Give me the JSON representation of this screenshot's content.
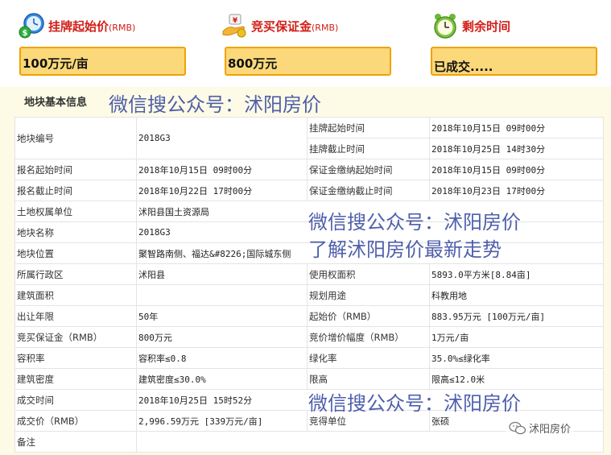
{
  "header": {
    "start_price_label": "挂牌起始价",
    "deposit_label": "竞买保证金",
    "remaining_label": "剩余时间",
    "unit_rmb": "(RMB)"
  },
  "values": {
    "start_price": "100万元/亩",
    "deposit": "800万元",
    "remaining": "已成交....."
  },
  "section_title": "地块基本信息",
  "watermarks": {
    "w1": "微信搜公众号：沭阳房价",
    "w2": "微信搜公众号：沭阳房价",
    "w3": "了解沭阳房价最新走势",
    "w4": "微信搜公众号：沭阳房价"
  },
  "brand": "沭阳房价",
  "table": {
    "r1": {
      "l1": "地块编号",
      "v1": "2018G3",
      "l2": "挂牌起始时间",
      "v2": "2018年10月15日 09时00分"
    },
    "r1b": {
      "l2": "挂牌截止时间",
      "v2": "2018年10月25日 14时30分"
    },
    "r2": {
      "l1": "报名起始时间",
      "v1": "2018年10月15日 09时00分",
      "l2": "保证金缴纳起始时间",
      "v2": "2018年10月15日 09时00分"
    },
    "r3": {
      "l1": "报名截止时间",
      "v1": "2018年10月22日 17时00分",
      "l2": "保证金缴纳截止时间",
      "v2": "2018年10月23日 17时00分"
    },
    "r4": {
      "l1": "土地权属单位",
      "v1": "沭阳县国土资源局"
    },
    "r5": {
      "l1": "地块名称",
      "v1": "2018G3"
    },
    "r6": {
      "l1": "地块位置",
      "v1": "聚智路南侧、福达&#8226;国际城东侧"
    },
    "r7": {
      "l1": "所属行政区",
      "v1": "沭阳县",
      "l2": "使用权面积",
      "v2": "5893.0平方米[8.84亩]"
    },
    "r8": {
      "l1": "建筑面积",
      "v1": "",
      "l2": "规划用途",
      "v2": "科教用地"
    },
    "r9": {
      "l1": "出让年限",
      "v1": "50年",
      "l2": "起始价（RMB）",
      "v2": "883.95万元 [100万元/亩]"
    },
    "r10": {
      "l1": "竞买保证金（RMB）",
      "v1": "800万元",
      "l2": "竞价增价幅度（RMB）",
      "v2": "1万元/亩"
    },
    "r11": {
      "l1": "容积率",
      "v1": "容积率≤0.8",
      "l2": "绿化率",
      "v2": "35.0%≤绿化率"
    },
    "r12": {
      "l1": "建筑密度",
      "v1": "建筑密度≤30.0%",
      "l2": "限高",
      "v2": "限高≤12.0米"
    },
    "r13": {
      "l1": "成交时间",
      "v1": "2018年10月25日 15时52分"
    },
    "r14": {
      "l1": "成交价（RMB）",
      "v1": "2,996.59万元 [339万元/亩]",
      "l2": "竞得单位",
      "v2": "张硕"
    },
    "r15": {
      "l1": "备注",
      "v1": ""
    }
  },
  "colors": {
    "accent_red": "#d11f17",
    "box_fill": "#fbd87a",
    "box_border": "#f0a300",
    "watermark_blue": "#3c4ea3"
  },
  "icons": {
    "start_price": "money-clock-icon",
    "deposit": "money-hand-icon",
    "remaining": "alarm-clock-icon",
    "brand": "wechat-icon"
  }
}
